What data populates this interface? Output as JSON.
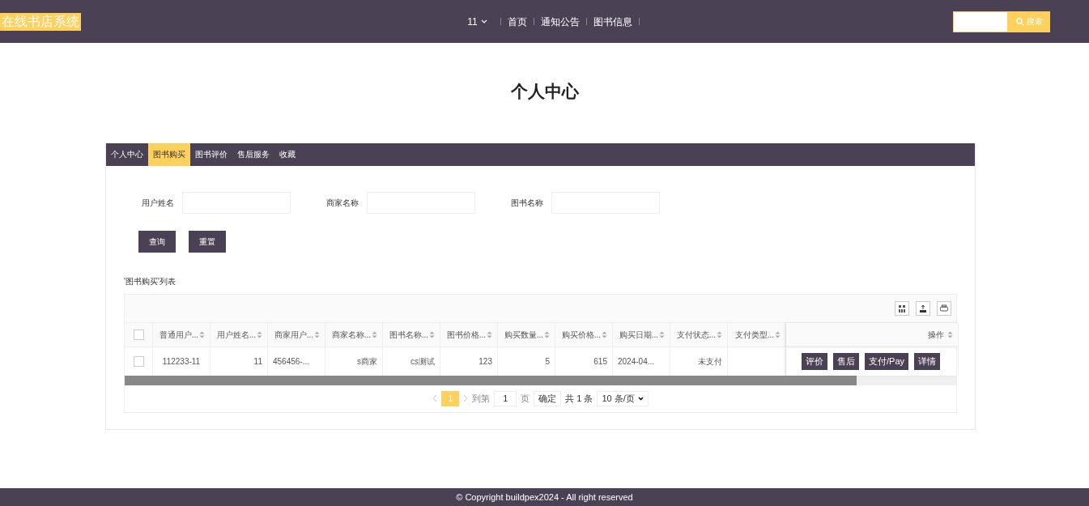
{
  "brand": "在线书店系统",
  "nav": {
    "user": "11",
    "links": [
      "首页",
      "通知公告",
      "图书信息"
    ]
  },
  "search": {
    "button": "搜索"
  },
  "page_title": "个人中心",
  "tabs": [
    {
      "label": "个人中心",
      "selected": false
    },
    {
      "label": "图书购买",
      "selected": true
    },
    {
      "label": "图书评价",
      "selected": false
    },
    {
      "label": "售后服务",
      "selected": false
    },
    {
      "label": "收藏",
      "selected": false
    }
  ],
  "filters": [
    {
      "label": "用户姓名"
    },
    {
      "label": "商家名称"
    },
    {
      "label": "图书名称"
    }
  ],
  "filter_buttons": [
    "查询",
    "重置"
  ],
  "table": {
    "caption": "'图书购买'列表",
    "header_checked": false,
    "columns": [
      "普通用户...",
      "用户姓名...",
      "商家用户...",
      "商家名称...",
      "图书名称...",
      "图书价格...",
      "购买数量...",
      "购买价格...",
      "购买日期...",
      "支付状态...",
      "支付类型..."
    ],
    "action_column": "操作",
    "rows": [
      {
        "checked": false,
        "cells": [
          "112233-11",
          "11",
          "456456-...",
          "s商家",
          "cs测试",
          "123",
          "5",
          "615",
          "2024-04...",
          "未支付",
          null
        ],
        "actions": [
          "评价",
          "售后",
          "支付/Pay",
          "详情"
        ]
      }
    ]
  },
  "pagination": {
    "pages": [
      {
        "label": "1",
        "selected": true
      }
    ],
    "goto_label": "到第",
    "goto_value": "1",
    "page_unit": "页",
    "confirm": "确定",
    "total": "共 1 条",
    "page_size": "10 条/页"
  },
  "footer": "© Copyright buildpex2024 - All right reserved"
}
